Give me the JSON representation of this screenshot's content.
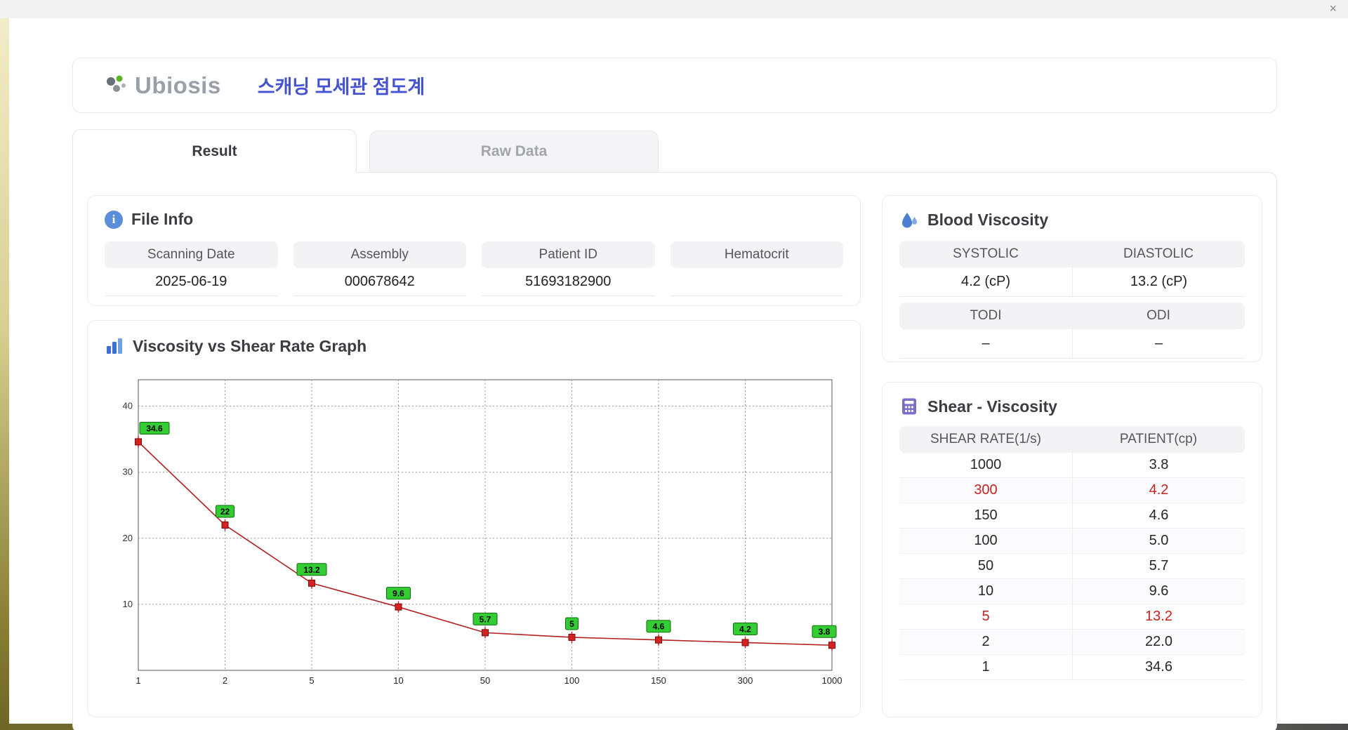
{
  "window": {
    "close_label": "×"
  },
  "header": {
    "logo_text": "Ubiosis",
    "title": "스캐닝 모세관 점도계"
  },
  "tabs": [
    {
      "label": "Result",
      "active": true
    },
    {
      "label": "Raw Data",
      "active": false
    }
  ],
  "file_info": {
    "section_title": "File Info",
    "fields": [
      {
        "label": "Scanning Date",
        "value": "2025-06-19"
      },
      {
        "label": "Assembly",
        "value": "000678642"
      },
      {
        "label": "Patient ID",
        "value": "51693182900"
      },
      {
        "label": "Hematocrit",
        "value": ""
      }
    ]
  },
  "blood_viscosity": {
    "section_title": "Blood Viscosity",
    "cells": [
      {
        "label": "SYSTOLIC",
        "value": "4.2 (cP)"
      },
      {
        "label": "DIASTOLIC",
        "value": "13.2 (cP)"
      },
      {
        "label": "TODI",
        "value": "–"
      },
      {
        "label": "ODI",
        "value": "–"
      }
    ]
  },
  "shear_viscosity": {
    "section_title": "Shear - Viscosity",
    "columns": [
      "SHEAR RATE(1/s)",
      "PATIENT(cp)"
    ],
    "highlight_color": "#c62222",
    "rows": [
      {
        "shear_rate": "1000",
        "patient": "3.8",
        "highlight": false
      },
      {
        "shear_rate": "300",
        "patient": "4.2",
        "highlight": true
      },
      {
        "shear_rate": "150",
        "patient": "4.6",
        "highlight": false
      },
      {
        "shear_rate": "100",
        "patient": "5.0",
        "highlight": false
      },
      {
        "shear_rate": "50",
        "patient": "5.7",
        "highlight": false
      },
      {
        "shear_rate": "10",
        "patient": "9.6",
        "highlight": false
      },
      {
        "shear_rate": "5",
        "patient": "13.2",
        "highlight": true
      },
      {
        "shear_rate": "2",
        "patient": "22.0",
        "highlight": false
      },
      {
        "shear_rate": "1",
        "patient": "34.6",
        "highlight": false
      }
    ]
  },
  "graph": {
    "section_title": "Viscosity vs Shear Rate Graph"
  },
  "chart_data": {
    "type": "line",
    "title": "Viscosity vs Shear Rate Graph",
    "xlabel": "",
    "ylabel": "",
    "x_labels": [
      "1",
      "2",
      "5",
      "10",
      "50",
      "100",
      "150",
      "300",
      "1000"
    ],
    "values": [
      34.6,
      22,
      13.2,
      9.6,
      5.7,
      5,
      4.6,
      4.2,
      3.8
    ],
    "point_labels": [
      "34.6",
      "22",
      "13.2",
      "9.6",
      "5.7",
      "5",
      "4.6",
      "4.2",
      "3.8"
    ],
    "y_ticks": [
      10,
      20,
      30,
      40
    ],
    "ylim": [
      0,
      44
    ],
    "grid": true,
    "legend": "none",
    "line_color": "#b22020",
    "marker_color": "#d42222",
    "marker_edge": "#7a0c0c",
    "label_bg": "#33cc33",
    "label_edge": "#0e6e0e"
  }
}
